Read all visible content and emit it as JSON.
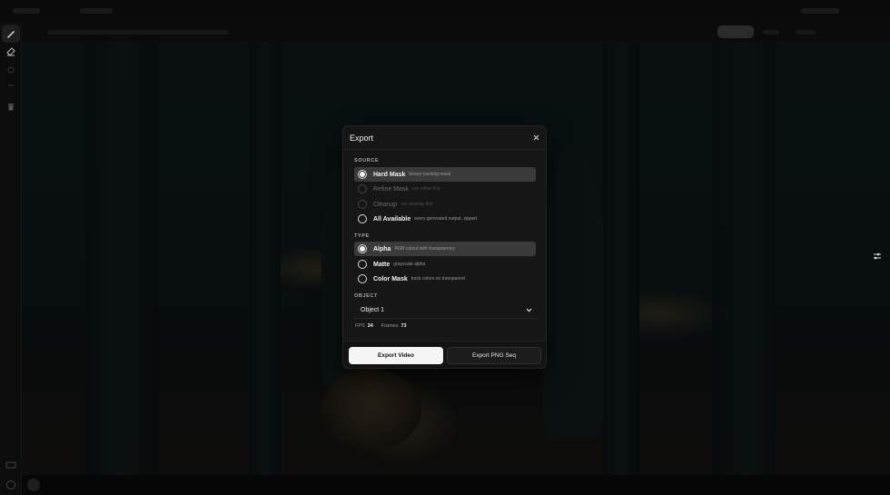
{
  "modal": {
    "title": "Export",
    "source_label": "SOURCE",
    "source_options": [
      {
        "label": "Hard Mask",
        "desc": "binary tracking mask",
        "selected": true,
        "disabled": false
      },
      {
        "label": "Refine Mask",
        "desc": "run refine first",
        "selected": false,
        "disabled": true
      },
      {
        "label": "Cleanup",
        "desc": "run cleanup first",
        "selected": false,
        "disabled": true
      },
      {
        "label": "All Available",
        "desc": "every generated output, zipped",
        "selected": false,
        "disabled": false
      }
    ],
    "type_label": "TYPE",
    "type_options": [
      {
        "label": "Alpha",
        "desc": "RGB cutout with transparency",
        "selected": true
      },
      {
        "label": "Matte",
        "desc": "grayscale alpha",
        "selected": false
      },
      {
        "label": "Color Mask",
        "desc": "track colors on transparent",
        "selected": false
      }
    ],
    "object_label": "OBJECT",
    "object_value": "Object 1",
    "fps_label": "FPS",
    "fps_value": "24",
    "frames_label": "Frames",
    "frames_value": "73",
    "export_video_label": "Export Video",
    "export_png_label": "Export PNG Seq"
  },
  "icons": {
    "close": "close-icon",
    "chevron": "chevron-down-icon",
    "brush": "brush-icon",
    "eraser": "eraser-icon",
    "trash": "trash-icon",
    "adjust": "sliders-icon"
  },
  "colors": {
    "modal_bg": "#161616",
    "selected_row": "#3a3a3a",
    "primary_button": "#f5f5f5"
  }
}
